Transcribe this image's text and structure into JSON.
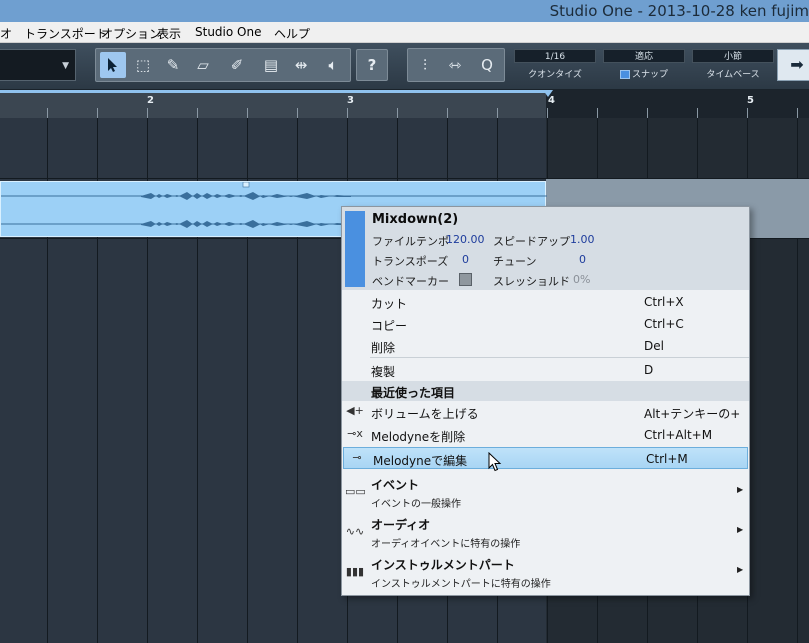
{
  "window": {
    "title": "Studio One - 2013-10-28 ken fujim"
  },
  "menu": [
    "オ",
    "トランスポート",
    "オプション",
    "表示",
    "Studio One",
    "ヘルプ"
  ],
  "toolbar": {
    "help_label": "?",
    "quantize_value": "1/16",
    "quantize_label": "クオンタイズ",
    "snap_value": "適応",
    "snap_label": "スナップ",
    "timebase_value": "小節",
    "timebase_label": "タイムベース",
    "q_label": "Q"
  },
  "ruler": {
    "marks": [
      "2",
      "3",
      "4",
      "5"
    ]
  },
  "context_menu": {
    "event_name": "Mixdown(2)",
    "info": {
      "file_tempo_label": "ファイルテンポ",
      "file_tempo_value": "120.00",
      "speedup_label": "スピードアップ",
      "speedup_value": "1.00",
      "transpose_label": "トランスポーズ",
      "transpose_value": "0",
      "tune_label": "チューン",
      "tune_value": "0",
      "bend_label": "ベンドマーカー",
      "threshold_label": "スレッショルド",
      "threshold_value": "0%"
    },
    "items": [
      {
        "label": "カット",
        "shortcut": "Ctrl+X"
      },
      {
        "label": "コピー",
        "shortcut": "Ctrl+C"
      },
      {
        "label": "削除",
        "shortcut": "Del"
      },
      {
        "label": "複製",
        "shortcut": "D"
      }
    ],
    "recent_header": "最近使った項目",
    "recent": [
      {
        "label": "ボリュームを上げる",
        "shortcut": "Alt+テンキーの+",
        "icon": "volume-up-icon"
      },
      {
        "label": "Melodyneを削除",
        "shortcut": "Ctrl+Alt+M",
        "icon": "melodyne-delete-icon"
      },
      {
        "label": "Melodyneで編集",
        "shortcut": "Ctrl+M",
        "icon": "melodyne-icon"
      }
    ],
    "submenus": [
      {
        "label": "イベント",
        "desc": "イベントの一般操作"
      },
      {
        "label": "オーディオ",
        "desc": "オーディオイベントに特有の操作"
      },
      {
        "label": "インストゥルメントパート",
        "desc": "インストゥルメントパートに特有の操作"
      }
    ]
  }
}
